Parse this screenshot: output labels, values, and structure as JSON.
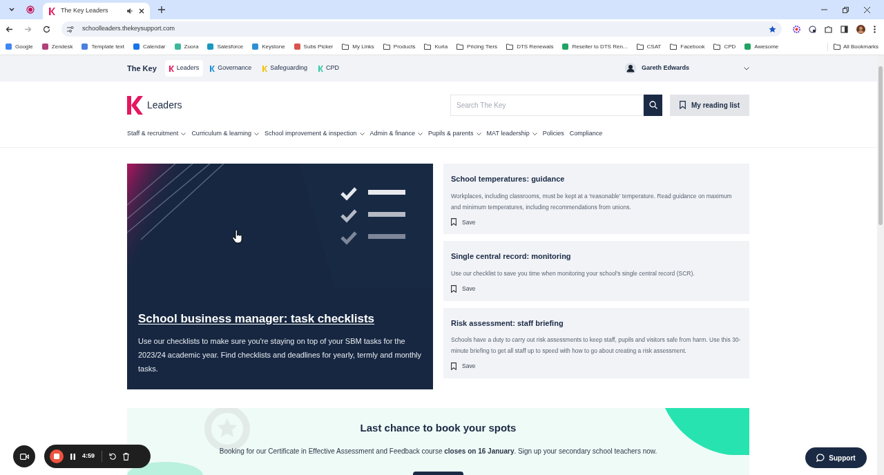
{
  "browser": {
    "tab_title": "The Key Leaders",
    "url": "schoolleaders.thekeysupport.com",
    "bookmarks": [
      {
        "label": "Google",
        "kind": "app",
        "color": "#4285f4"
      },
      {
        "label": "Zendesk",
        "kind": "app",
        "color": "#b0417a"
      },
      {
        "label": "Template text",
        "kind": "app",
        "color": "#4a7fe0"
      },
      {
        "label": "Calendar",
        "kind": "app",
        "color": "#1a73e8"
      },
      {
        "label": "Zuora",
        "kind": "app",
        "color": "#3cb89a"
      },
      {
        "label": "Salesforce",
        "kind": "app",
        "color": "#1798c1"
      },
      {
        "label": "Keystone",
        "kind": "app",
        "color": "#2f8fd6"
      },
      {
        "label": "Subs Picker",
        "kind": "app",
        "color": "#d9534f"
      },
      {
        "label": "My Links",
        "kind": "folder"
      },
      {
        "label": "Products",
        "kind": "folder"
      },
      {
        "label": "Kuria",
        "kind": "folder"
      },
      {
        "label": "Pricing Tiers",
        "kind": "folder"
      },
      {
        "label": "DTS Renewals",
        "kind": "folder"
      },
      {
        "label": "Reseller to DTS Ren...",
        "kind": "app",
        "color": "#1fa463"
      },
      {
        "label": "CSAT",
        "kind": "folder"
      },
      {
        "label": "Facebook",
        "kind": "folder"
      },
      {
        "label": "CPD",
        "kind": "folder"
      },
      {
        "label": "Awesome",
        "kind": "app",
        "color": "#1fa463"
      }
    ],
    "all_bookmarks": "All Bookmarks"
  },
  "site": {
    "brand": "The Key",
    "products": [
      {
        "label": "Leaders",
        "selected": true,
        "color": "#e5175f"
      },
      {
        "label": "Governance",
        "selected": false,
        "color": "#1c8fd1"
      },
      {
        "label": "Safeguarding",
        "selected": false,
        "color": "#f2c200"
      },
      {
        "label": "CPD",
        "selected": false,
        "color": "#2fc7a3"
      }
    ],
    "user": "Gareth Edwards",
    "logo_text": "Leaders",
    "search": {
      "placeholder": "Search The Key"
    },
    "reading_list": "My reading list",
    "nav": [
      {
        "label": "Staff & recruitment",
        "dropdown": true
      },
      {
        "label": "Curriculum & learning",
        "dropdown": true
      },
      {
        "label": "School improvement & inspection",
        "dropdown": true
      },
      {
        "label": "Admin & finance",
        "dropdown": true
      },
      {
        "label": "Pupils & parents",
        "dropdown": true
      },
      {
        "label": "MAT leadership",
        "dropdown": true
      },
      {
        "label": "Policies",
        "dropdown": false
      },
      {
        "label": "Compliance",
        "dropdown": false
      }
    ],
    "feature": {
      "title": "School business manager: task checklists",
      "text": "Use our checklists to make sure you're staying on top of your SBM tasks for the 2023/24 academic year. Find checklists and deadlines for yearly, termly and monthly tasks."
    },
    "articles": [
      {
        "title": "School temperatures: guidance",
        "text": "Workplaces, including classrooms, must be kept at a 'reasonable' temperature. Read guidance on maximum and minimum temperatures, including recommendations from unions.",
        "save": "Save"
      },
      {
        "title": "Single central record: monitoring",
        "text": "Use our checklist to save you time when monitoring your school's single central record (SCR).",
        "save": "Save"
      },
      {
        "title": "Risk assessment: staff briefing",
        "text": "Schools have a duty to carry out risk assessments to keep staff, pupils and visitors safe from harm. Use this 30-minute briefing to get all staff up to speed with how to go about creating a risk assessment.",
        "save": "Save"
      }
    ],
    "banner": {
      "title": "Last chance to book your spots",
      "text": "Booking for our Certificate in Effective Assessment and Feedback course **closes on 16 January**. Sign up your secondary school teachers now."
    },
    "support": "Support"
  },
  "recorder": {
    "time": "4:59"
  }
}
